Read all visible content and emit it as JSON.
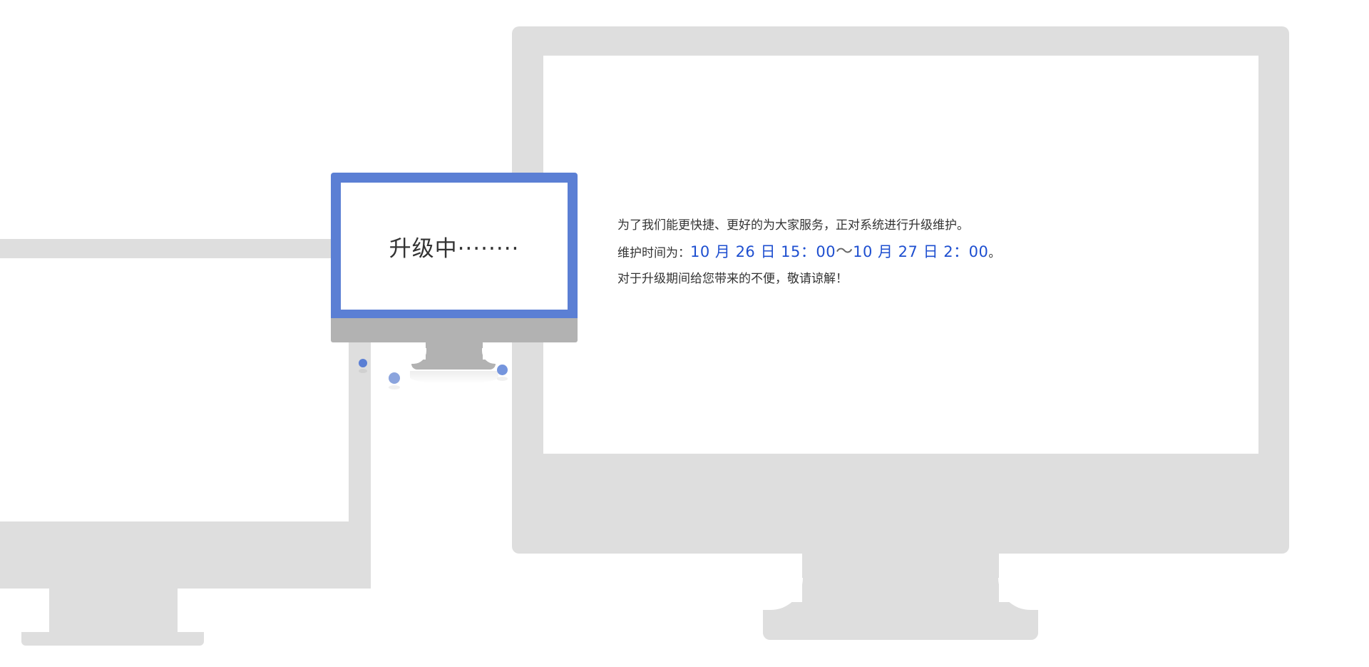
{
  "monitor": {
    "status_text": "升级中········"
  },
  "message": {
    "line1": "为了我们能更快捷、更好的为大家服务，正对系统进行升级维护。",
    "line2_prefix": "维护时间为：",
    "start_time": "10 月 26 日 15：00",
    "separator": "～",
    "end_time": "10 月 27 日 2：00",
    "line2_suffix": "。",
    "line3": "对于升级期间给您带来的不便，敬请谅解！"
  },
  "colors": {
    "accent": "#5b7fd4",
    "highlight_text": "#1e4fd0",
    "frame_gray": "#dedede",
    "stand_gray": "#b2b2b2"
  }
}
